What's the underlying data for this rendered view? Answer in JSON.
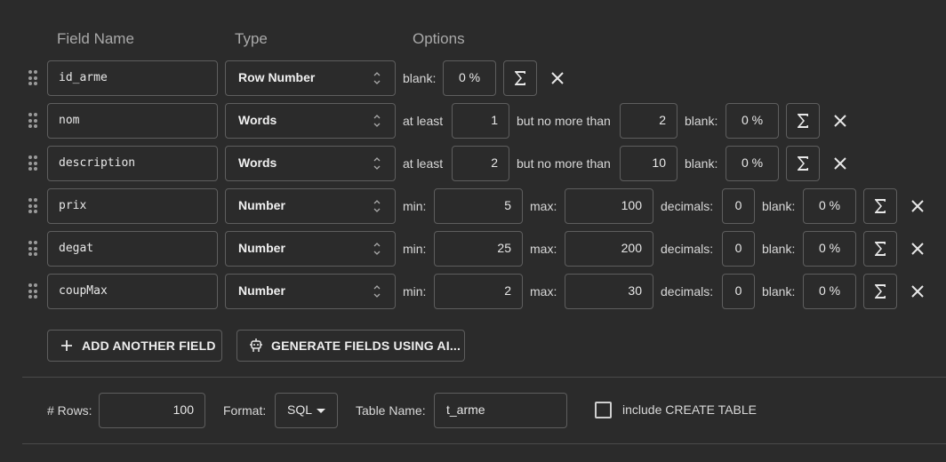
{
  "headers": {
    "field_name": "Field Name",
    "type": "Type",
    "options": "Options"
  },
  "labels": {
    "blank": "blank:",
    "at_least": "at least",
    "no_more_than": "but no more than",
    "min": "min:",
    "max": "max:",
    "decimals": "decimals:"
  },
  "fields": [
    {
      "name": "id_arme",
      "type": "Row Number",
      "blank": "0 %"
    },
    {
      "name": "nom",
      "type": "Words",
      "at_least": "1",
      "no_more_than": "2",
      "blank": "0 %"
    },
    {
      "name": "description",
      "type": "Words",
      "at_least": "2",
      "no_more_than": "10",
      "blank": "0 %"
    },
    {
      "name": "prix",
      "type": "Number",
      "min": "5",
      "max": "100",
      "decimals": "0",
      "blank": "0 %"
    },
    {
      "name": "degat",
      "type": "Number",
      "min": "25",
      "max": "200",
      "decimals": "0",
      "blank": "0 %"
    },
    {
      "name": "coupMax",
      "type": "Number",
      "min": "2",
      "max": "30",
      "decimals": "0",
      "blank": "0 %"
    }
  ],
  "actions": {
    "add_field": "ADD ANOTHER FIELD",
    "generate_ai": "GENERATE FIELDS USING AI..."
  },
  "footer": {
    "rows_label": "# Rows:",
    "rows_value": "100",
    "format_label": "Format:",
    "format_value": "SQL",
    "table_name_label": "Table Name:",
    "table_name_value": "t_arme",
    "create_table_label": "include CREATE TABLE",
    "create_table_checked": false
  }
}
